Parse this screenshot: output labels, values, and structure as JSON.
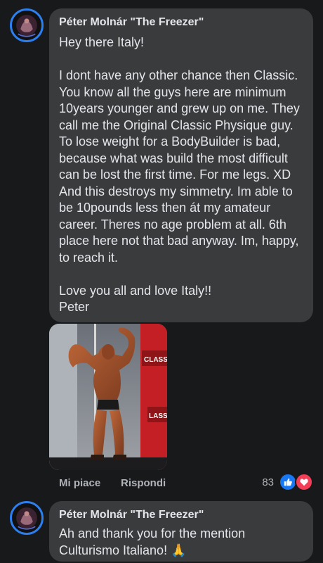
{
  "comments": [
    {
      "author": "Péter Molnár \"The Freezer\"",
      "paragraphs": [
        "Hey there Italy!",
        "I dont have any other chance then Classic. You know all the guys here are minimum 10years younger and grew up on me. They call me the Original Classic Physique guy. To lose weight for a BodyBuilder is bad, because what was build the most difficult can be lost the first time. For me legs. XD And this destroys my simmetry. Im able to be 10pounds less then át my amateur career. Theres no age problem at all. 6th place here not that bad anyway. Im, happy, to reach it.",
        "Love you all and love Italy!!",
        "Peter"
      ],
      "photo": {
        "banner_text_top": "CLASSIC",
        "banner_text_bottom": "LASSI"
      },
      "actions": {
        "like_label": "Mi piace",
        "reply_label": "Rispondi"
      },
      "reactions": {
        "count": "83",
        "types": [
          "like-icon",
          "love-icon"
        ],
        "like_color": "#1877f2",
        "love_color": "#f33e58"
      }
    },
    {
      "author": "Péter Molnár \"The Freezer\"",
      "line1": "Ah and thank you for the mention",
      "line2": "Culturismo Italiano! 🙏"
    }
  ]
}
